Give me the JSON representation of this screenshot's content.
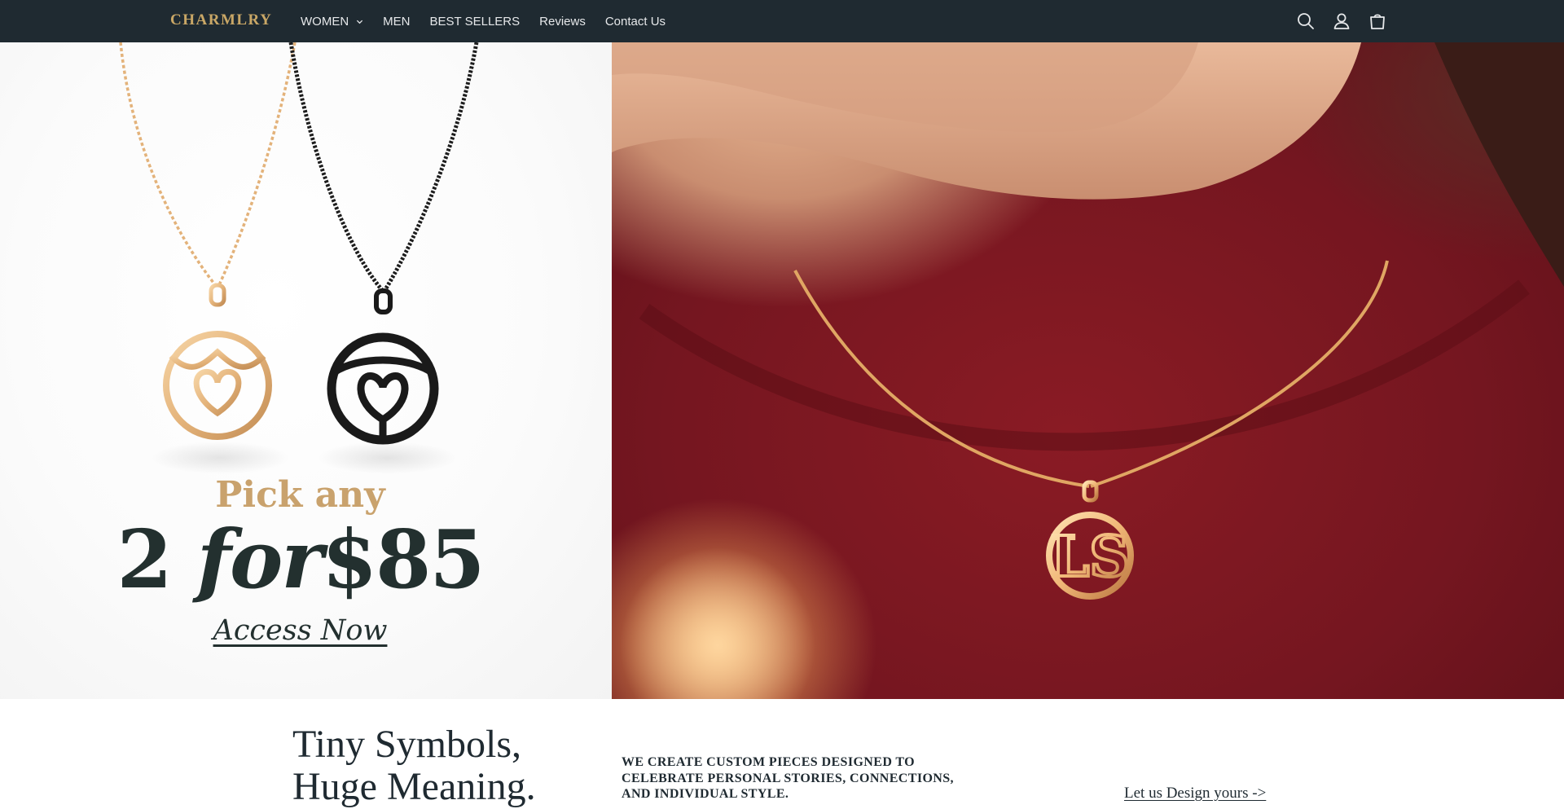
{
  "header": {
    "logo": "CHARMLRY",
    "nav": [
      {
        "label": "WOMEN",
        "has_dropdown": true
      },
      {
        "label": "MEN"
      },
      {
        "label": "BEST SELLERS"
      },
      {
        "label": "Reviews"
      },
      {
        "label": "Contact Us"
      }
    ],
    "icons": [
      "search-icon",
      "account-icon",
      "cart-icon"
    ]
  },
  "hero": {
    "promo": {
      "line1": "Pick any",
      "qty": "2",
      "for": "for",
      "price": "$85",
      "cta": "Access Now"
    },
    "pendant_monogram": "LS"
  },
  "section": {
    "tagline_line1": "Tiny Symbols,",
    "tagline_line2": "Huge Meaning.",
    "about": "WE CREATE CUSTOM PIECES DESIGNED TO CELEBRATE PERSONAL STORIES, CONNECTIONS, AND INDIVIDUAL STYLE.",
    "design_link": "Let us Design yours ->"
  },
  "colors": {
    "header_bg": "#1f2a31",
    "logo_gold": "#c9a766",
    "promo_gold": "#c9a26d",
    "promo_dark": "#23302f",
    "sweater_red": "#7a1820"
  }
}
